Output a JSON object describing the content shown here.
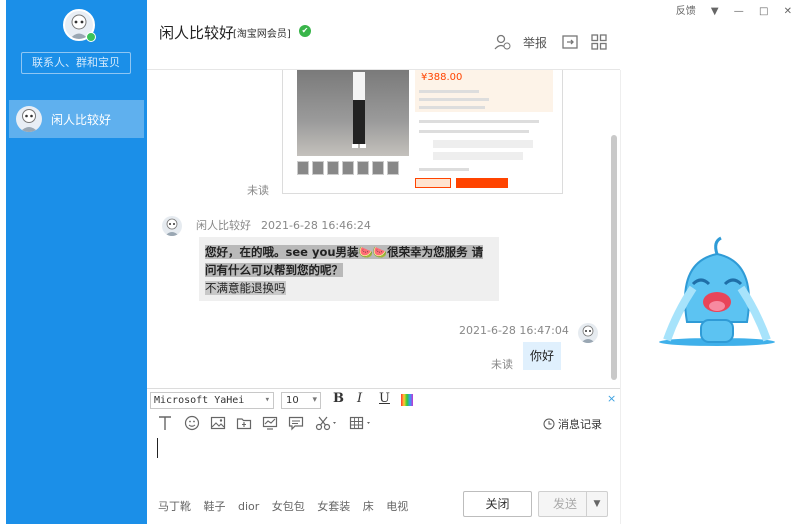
{
  "sidebar": {
    "search_placeholder": "联系人、群和宝贝",
    "contacts": [
      {
        "name": "闲人比较好"
      }
    ]
  },
  "window": {
    "feedback": "反馈",
    "menu": "▼",
    "minimize": "—",
    "maximize": "□",
    "close": "✕"
  },
  "header": {
    "title": "闲人比较好",
    "member": "[淘宝网会员]",
    "report": "举报"
  },
  "product": {
    "price": "¥388.00"
  },
  "messages": [
    {
      "direction": "in",
      "sender": "闲人比较好",
      "time": "2021-6-28 16:46:24",
      "line1": "您好，在的哦。see you男装🍉🍉很荣幸为您服务 请",
      "line2": "问有什么可以帮到您的呢？",
      "line3": "不满意能退换吗"
    },
    {
      "direction": "out",
      "time": "2021-6-28 16:47:04",
      "text": "你好",
      "status": "未读"
    }
  ],
  "first_status": "未读",
  "toolbar": {
    "font": "Microsoft YaHei",
    "size": "10",
    "bold": "B",
    "italic": "I",
    "underline": "U",
    "close_x": "×",
    "history": "消息记录"
  },
  "quick_tags": [
    "马丁靴",
    "鞋子",
    "dior",
    "女包包",
    "女套装",
    "床",
    "电视"
  ],
  "buttons": {
    "close": "关闭",
    "send": "发送"
  },
  "colors": {
    "sidebar": "#1b8fe8",
    "active_contact": "#5fb0ee",
    "accent": "#3aa0e0",
    "badge": "#39b54a"
  }
}
